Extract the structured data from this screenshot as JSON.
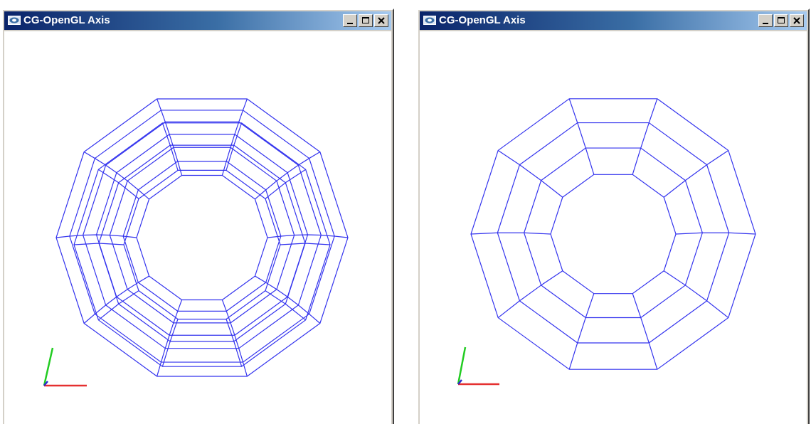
{
  "windows": [
    {
      "title": "CG-OpenGL Axis",
      "mesh_color": "#3333ee"
    },
    {
      "title": "CG-OpenGL Axis",
      "mesh_color": "#3333ee"
    }
  ],
  "colors": {
    "titlebar_start": "#0a246a",
    "titlebar_end": "#a6caf0",
    "axis_x": "#e53030",
    "axis_y": "#22cc22",
    "axis_z": "#2a2ad0",
    "viewport_bg": "#ffffff"
  }
}
